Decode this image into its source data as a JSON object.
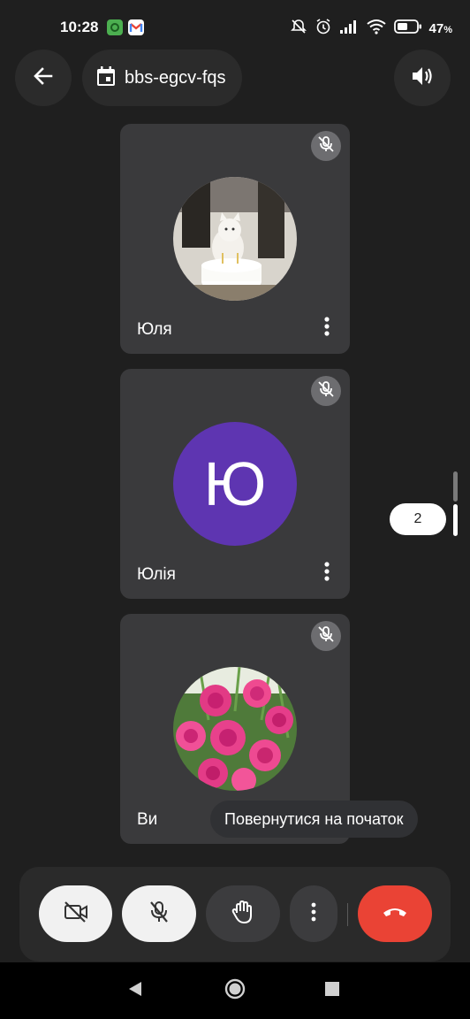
{
  "status_bar": {
    "time": "10:28",
    "battery_percent": "47",
    "battery_unit": "%",
    "icons": [
      "notification-app-icon",
      "gmail-icon",
      "do-not-disturb-icon",
      "alarm-icon",
      "signal-icon",
      "wifi-icon",
      "battery-icon"
    ]
  },
  "header": {
    "meeting_code": "bbs-egcv-fqs",
    "back_icon": "arrow-back-icon",
    "calendar_icon": "calendar-icon",
    "speaker_icon": "volume-icon"
  },
  "participants": [
    {
      "name": "Юля",
      "avatar": "photo-cat-cake",
      "muted": true
    },
    {
      "name": "Юлія",
      "avatar_letter": "Ю",
      "avatar_color": "#5e35b1",
      "muted": true
    },
    {
      "name": "Ви",
      "avatar": "photo-pink-roses",
      "muted": true
    }
  ],
  "pagination": {
    "page": "2"
  },
  "tooltip": {
    "text": "Повернутися на початок"
  },
  "controls": {
    "items": [
      "camera-off-icon",
      "mic-off-icon",
      "raise-hand-icon",
      "more-vert-icon",
      "end-call-icon"
    ]
  },
  "colors": {
    "background": "#1f1f1f",
    "tile": "#3a3a3c",
    "end_call": "#ea4335",
    "avatar_purple": "#5e35b1"
  }
}
